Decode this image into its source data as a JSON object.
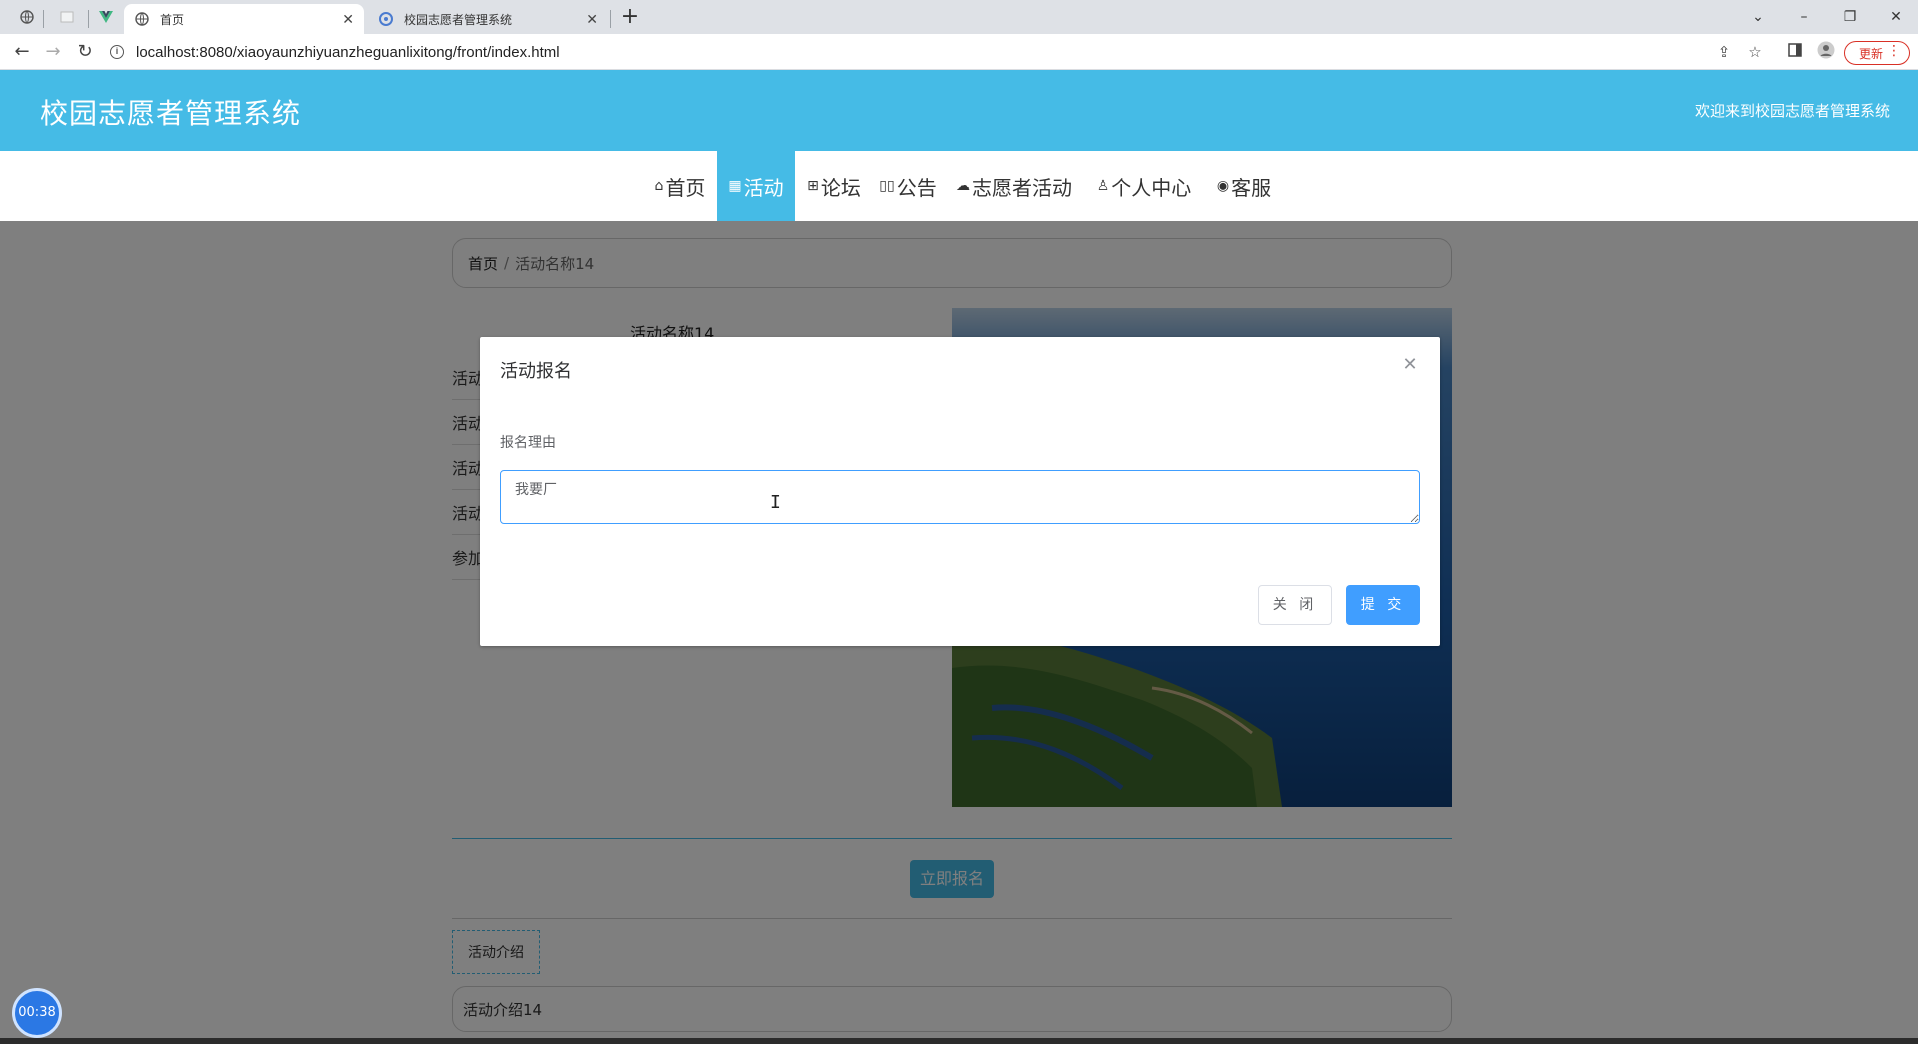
{
  "browser": {
    "tabs": [
      {
        "label": "首页",
        "active": true
      },
      {
        "label": "校园志愿者管理系统",
        "active": false
      }
    ],
    "url": "localhost:8080/xiaoyaunzhiyuanzheguanlixitong/front/index.html",
    "update_label": "更新"
  },
  "site": {
    "title": "校园志愿者管理系统",
    "welcome": "欢迎来到校园志愿者管理系统",
    "accent_color": "#45bbe6"
  },
  "nav": {
    "items": [
      {
        "label": "首页",
        "icon": "home-icon"
      },
      {
        "label": "活动",
        "icon": "grid-icon",
        "active": true
      },
      {
        "label": "论坛",
        "icon": "apps-icon"
      },
      {
        "label": "公告",
        "icon": "book-icon"
      },
      {
        "label": "志愿者活动",
        "icon": "cloud-icon"
      },
      {
        "label": "个人中心",
        "icon": "user-icon"
      },
      {
        "label": "客服",
        "icon": "chat-icon"
      }
    ]
  },
  "breadcrumb": {
    "home": "首页",
    "separator": "/",
    "current": "活动名称14"
  },
  "detail": {
    "title": "活动名称14",
    "row_labels": [
      "活动",
      "活动",
      "活动",
      "活动",
      "参加"
    ],
    "signup_button": "立即报名",
    "intro_tab": "活动介绍",
    "intro_content": "活动介绍14"
  },
  "dialog": {
    "title": "活动报名",
    "field_label": "报名理由",
    "field_value": "我要厂",
    "cancel_label": "关 闭",
    "submit_label": "提 交",
    "primary_color": "#409eff"
  },
  "recorder": {
    "time": "00:38"
  }
}
